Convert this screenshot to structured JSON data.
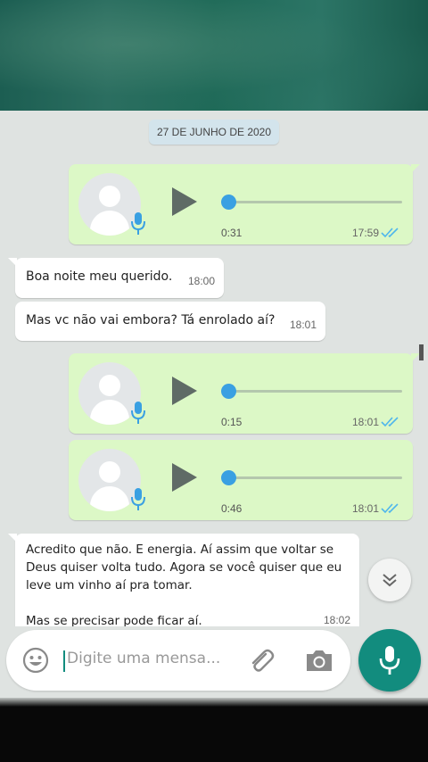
{
  "date_chip": "27 DE JUNHO DE 2020",
  "messages": [
    {
      "type": "voice",
      "dir": "out",
      "duration": "0:31",
      "time": "17:59",
      "status": "read"
    },
    {
      "type": "text",
      "dir": "in",
      "text": "Boa noite meu querido.",
      "time": "18:00"
    },
    {
      "type": "text",
      "dir": "in",
      "text": "Mas vc não vai embora? Tá enrolado aí?",
      "time": "18:01"
    },
    {
      "type": "voice",
      "dir": "out",
      "duration": "0:15",
      "time": "18:01",
      "status": "read"
    },
    {
      "type": "voice",
      "dir": "out",
      "duration": "0:46",
      "time": "18:01",
      "status": "read"
    },
    {
      "type": "text",
      "dir": "in",
      "lines": [
        "Acredito que não. E energia. Aí assim que voltar se",
        "Deus quiser volta tudo. Agora se você quiser que eu",
        "leve um vinho aí pra tomar.",
        "",
        "Mas se precisar pode ficar aí."
      ],
      "time": "18:02"
    }
  ],
  "composer": {
    "placeholder": "Digite uma mensa..."
  },
  "colors": {
    "outgoing_bubble": "#dcf8c6",
    "incoming_bubble": "#ffffff",
    "accent": "#128c7e",
    "read_ticks": "#4fb6ec",
    "progress_knob": "#3aa0e2"
  },
  "icons": [
    "mic-icon",
    "play-icon",
    "double-check-icon",
    "emoji-icon",
    "attach-icon",
    "camera-icon",
    "scroll-down-icon"
  ]
}
